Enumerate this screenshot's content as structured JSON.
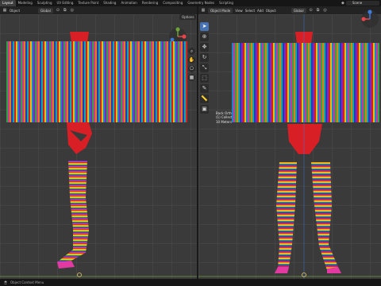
{
  "menubar": {
    "workspaces": [
      "Layout",
      "Modeling",
      "Sculpting",
      "UV Editing",
      "Texture Paint",
      "Shading",
      "Animation",
      "Rendering",
      "Compositing",
      "Geometry Nodes",
      "Scripting"
    ],
    "active_workspace": "Layout",
    "scene_label": "Scene"
  },
  "left_viewport": {
    "header": {
      "mode_label": "Object",
      "transform_label": "Global"
    },
    "options_label": "Options"
  },
  "right_viewport": {
    "header": {
      "mode_label": "Object Mode",
      "menus": [
        "View",
        "Select",
        "Add",
        "Object"
      ],
      "transform_label": "Global"
    },
    "overlay": {
      "view_name": "Back Orthographic",
      "collection_line": "(1) Collection | tarnsuit_hat_back_thin",
      "scale_line": "10 Meters"
    },
    "tools": [
      "select-box",
      "cursor",
      "move",
      "rotate",
      "scale",
      "transform",
      "annotate",
      "measure",
      "add-cube"
    ]
  },
  "statusbar": {
    "text": "Object Context Menu"
  },
  "colors": {
    "viewport_bg": "#3a3a3a",
    "accent": "#4772b3",
    "leotard_red": "#d81f26",
    "fringe_palette": [
      "#e52222",
      "#f28c12",
      "#f4d21a",
      "#34b24a",
      "#1d8fe0",
      "#2a3fc9",
      "#8b2bc9",
      "#e23aa0",
      "#13b8b0",
      "#ffffff"
    ],
    "stocking_stripes": [
      "#e52222",
      "#f28c12",
      "#f4d21a",
      "#34b24a",
      "#2a3fc9",
      "#8b2bc9",
      "#e23aa0"
    ]
  }
}
